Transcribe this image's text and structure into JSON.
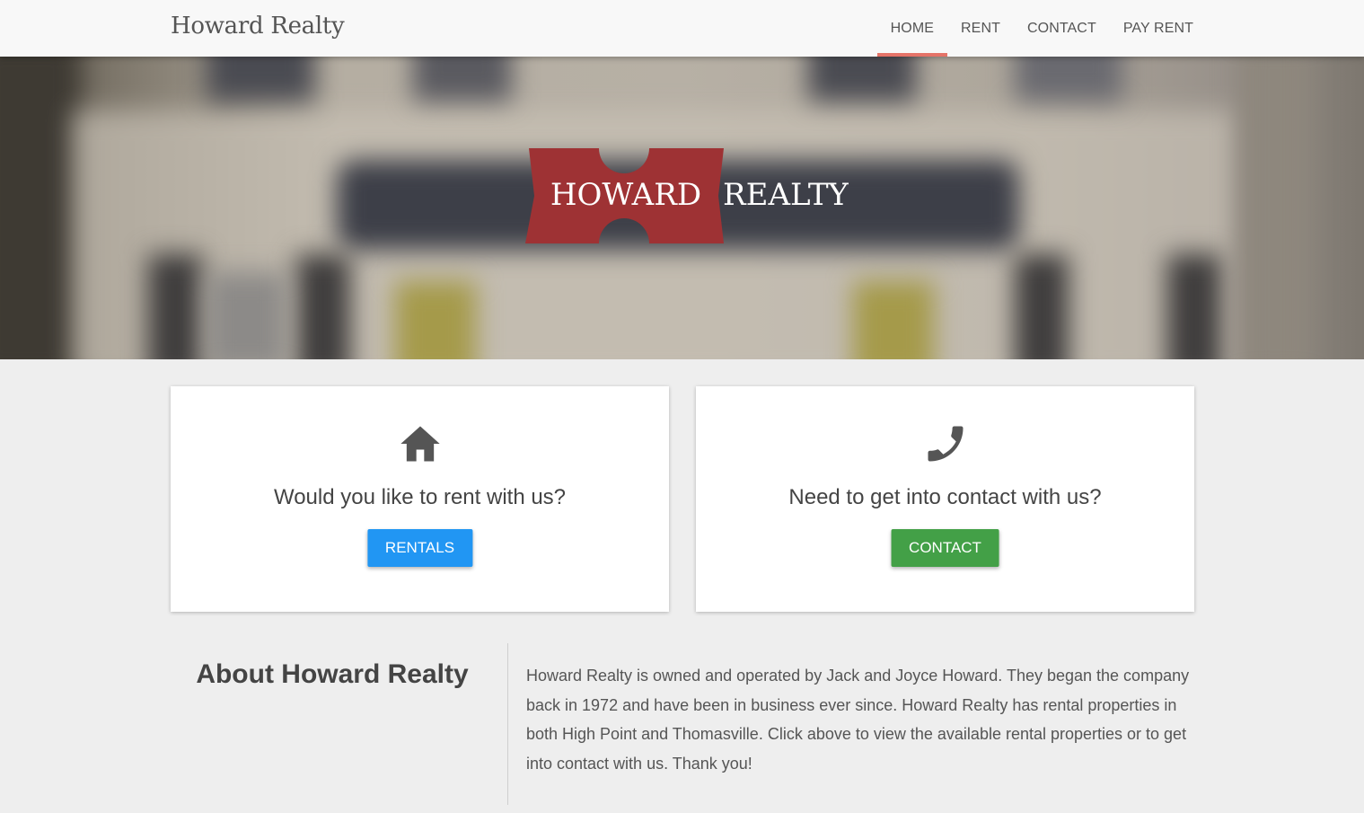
{
  "brand": "Howard Realty",
  "nav": [
    {
      "label": "HOME",
      "active": true
    },
    {
      "label": "RENT",
      "active": false
    },
    {
      "label": "CONTACT",
      "active": false
    },
    {
      "label": "PAY RENT",
      "active": false
    }
  ],
  "hero": {
    "logo_word1": "HOWARD",
    "logo_word2": "REALTY"
  },
  "cards": [
    {
      "icon": "house-icon",
      "title": "Would you like to rent with us?",
      "button": "RENTALS"
    },
    {
      "icon": "phone-icon",
      "title": "Need to get into contact with us?",
      "button": "CONTACT"
    }
  ],
  "about": {
    "title": "About Howard Realty",
    "text": "Howard Realty is owned and operated by Jack and Joyce Howard. They began the company back in 1972 and have been in business ever since. Howard Realty has rental properties in both High Point and Thomasville. Click above to view the available rental properties or to get into contact with us. Thank you!"
  },
  "colors": {
    "accent": "#e57368",
    "logo_red": "#9e3234",
    "rentals_button": "#2196f3",
    "contact_button": "#43a047",
    "background": "#eeeeee"
  }
}
